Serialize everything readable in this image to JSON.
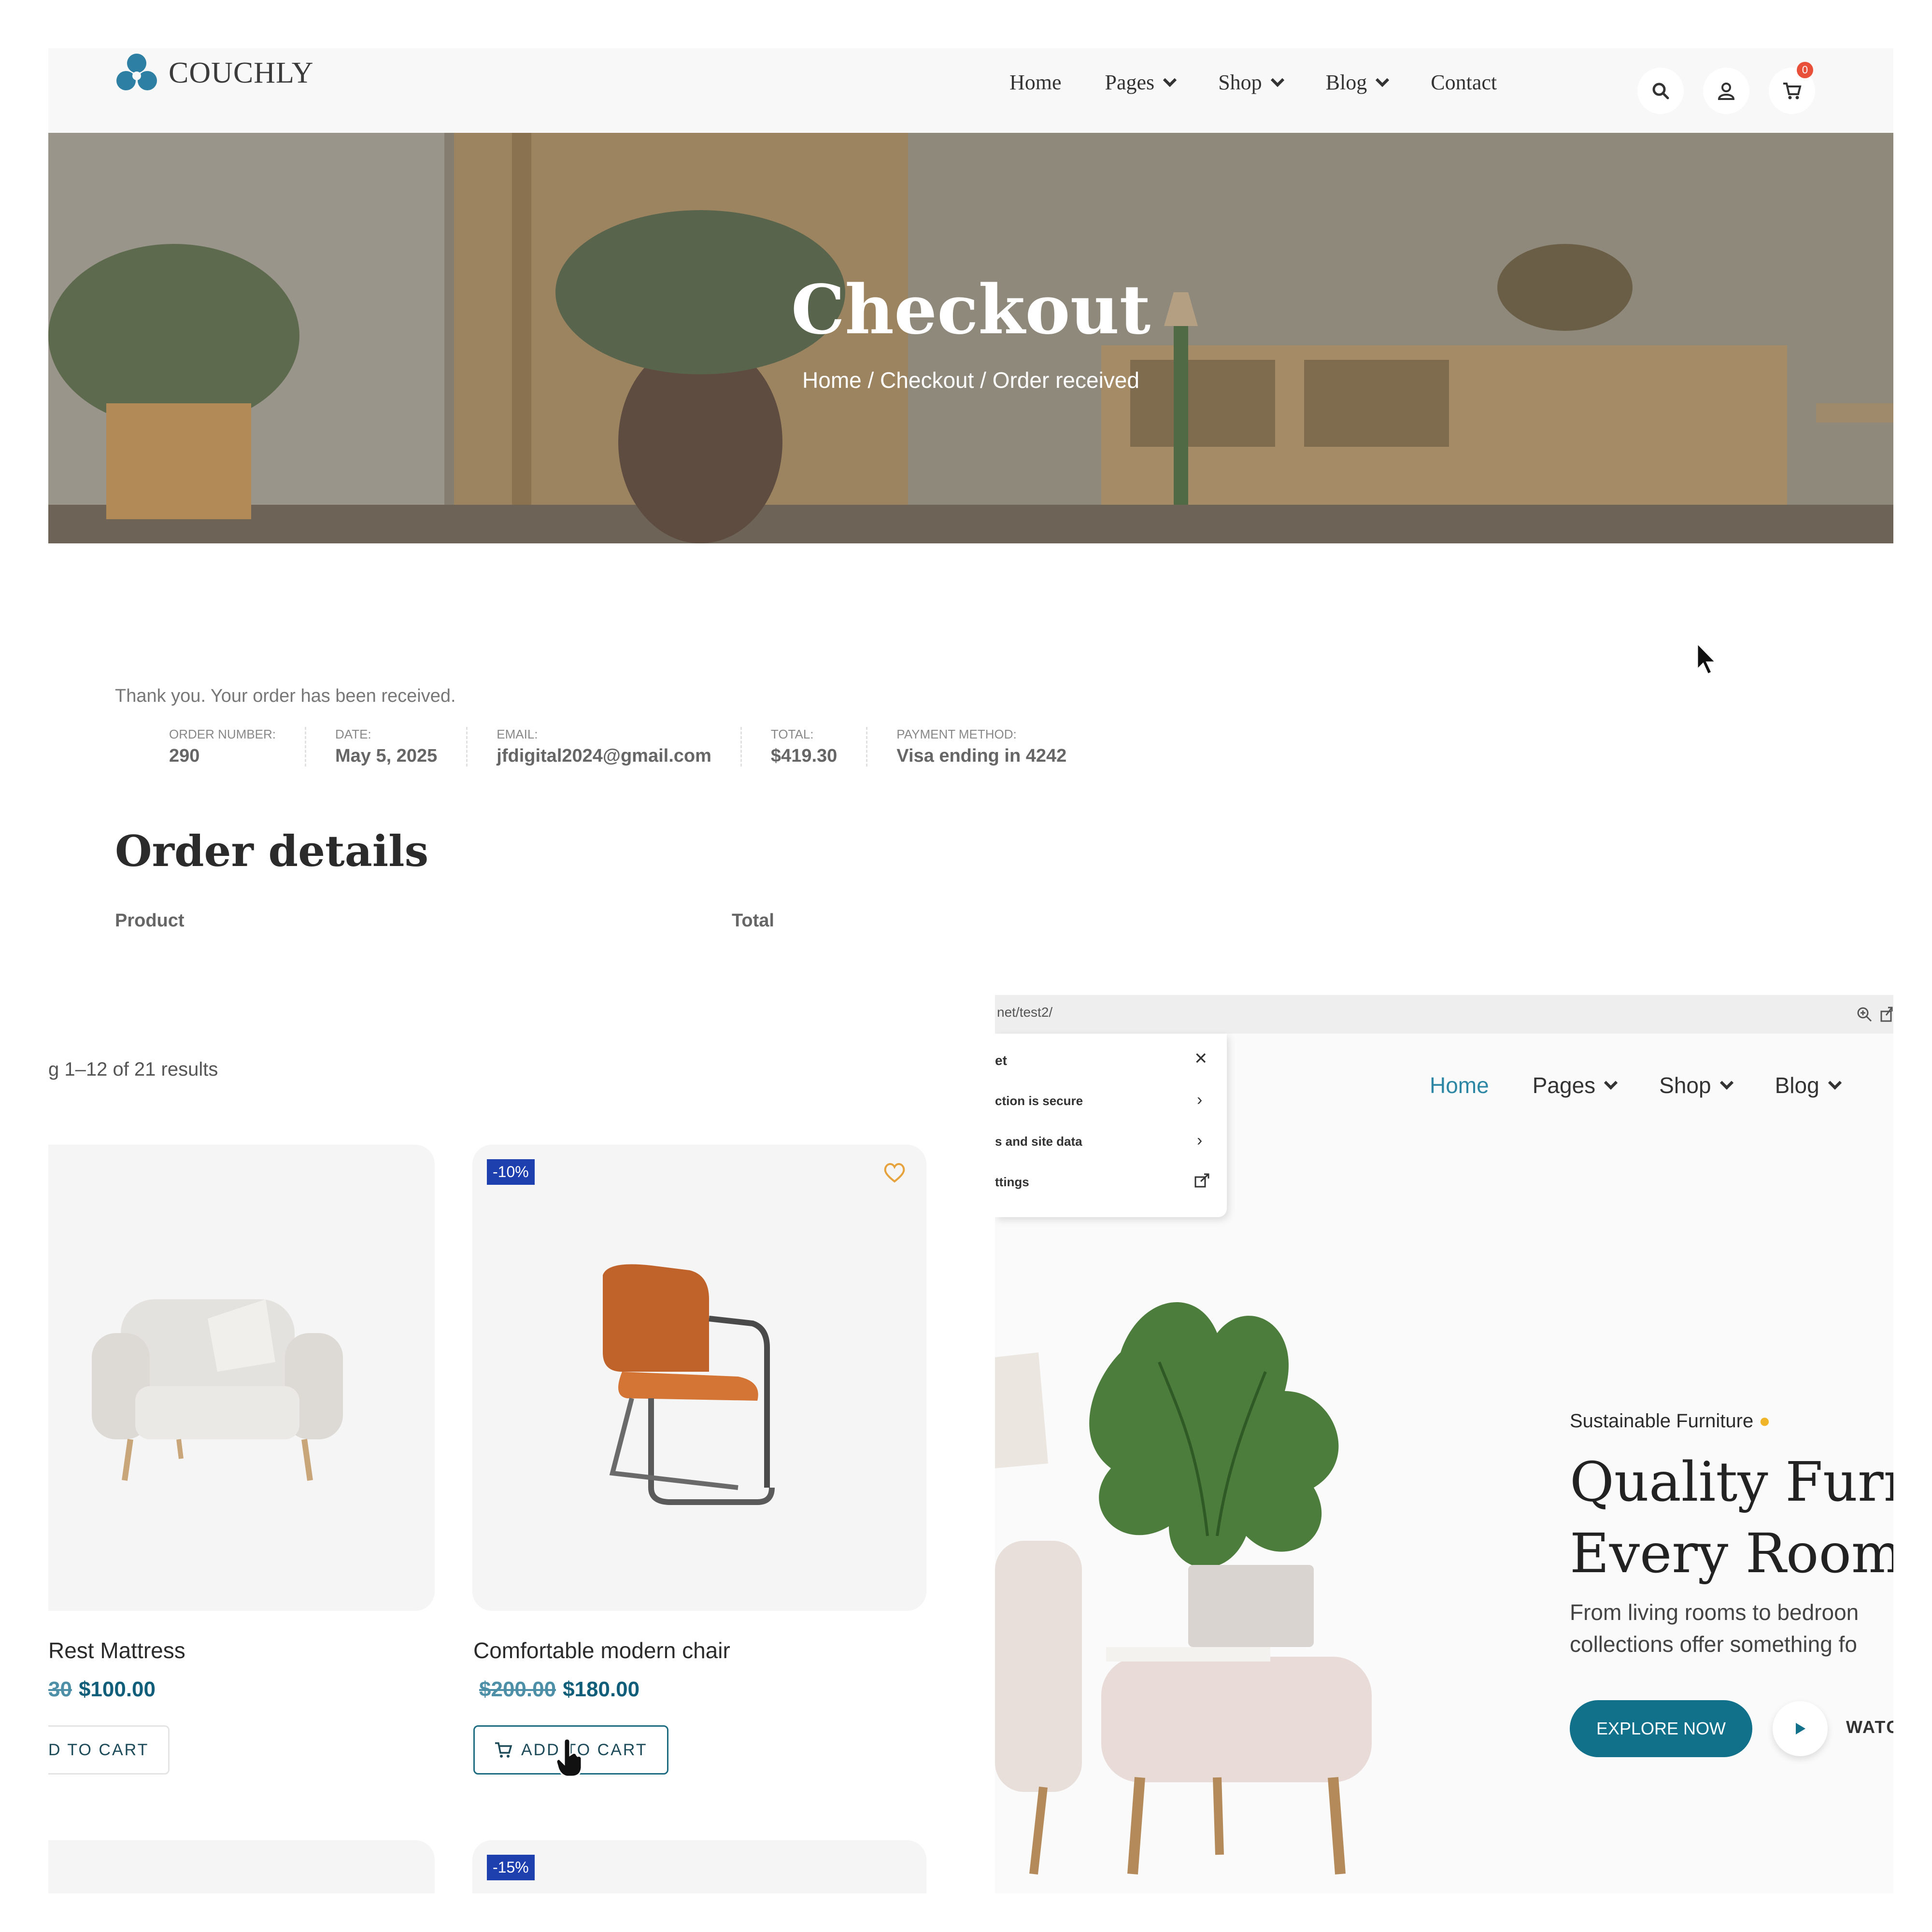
{
  "header": {
    "logo_text": "COUCHLY",
    "nav": [
      {
        "label": "Home"
      },
      {
        "label": "Pages"
      },
      {
        "label": "Shop"
      },
      {
        "label": "Blog"
      },
      {
        "label": "Contact"
      }
    ],
    "cart_count": "0"
  },
  "hero": {
    "title": "Checkout",
    "breadcrumb": "Home / Checkout / Order received"
  },
  "order": {
    "thanks": "Thank you. Your order has been received.",
    "fields": [
      {
        "label": "ORDER NUMBER:",
        "value": "290"
      },
      {
        "label": "DATE:",
        "value": "May 5, 2025"
      },
      {
        "label": "EMAIL:",
        "value": "jfdigital2024@gmail.com"
      },
      {
        "label": "TOTAL:",
        "value": "$419.30"
      },
      {
        "label": "PAYMENT METHOD:",
        "value": "Visa ending in 4242"
      }
    ],
    "details_title": "Order details",
    "col_product": "Product",
    "col_total": "Total"
  },
  "shop": {
    "results": "g 1–12 of 21 results",
    "products": [
      {
        "name": "Rest Mattress",
        "price_old": "30",
        "price_new": "$100.00",
        "cart_label": "D TO CART"
      },
      {
        "name": "Comfortable modern chair",
        "badge": "-10%",
        "price_old": "$200.00",
        "price_new": "$180.00",
        "cart_label": "ADD TO CART"
      }
    ],
    "next_badge": "-15%"
  },
  "right_panel": {
    "url": "net/test2/",
    "popup": {
      "title": "et",
      "items": [
        "ction is secure",
        "s and site data",
        "ttings"
      ]
    },
    "nav": [
      {
        "label": "Home"
      },
      {
        "label": "Pages"
      },
      {
        "label": "Shop"
      },
      {
        "label": "Blog"
      }
    ],
    "kicker": "Sustainable Furniture",
    "headline_1": "Quality Furn",
    "headline_2": "Every Room",
    "sub_1": "From living rooms to bedroon",
    "sub_2": "collections offer something fo",
    "explore_label": "EXPLORE NOW",
    "watch_label": "WATC"
  },
  "colors": {
    "accent": "#11708a",
    "badge": "#1e40af",
    "cart_badge": "#e8503a"
  }
}
